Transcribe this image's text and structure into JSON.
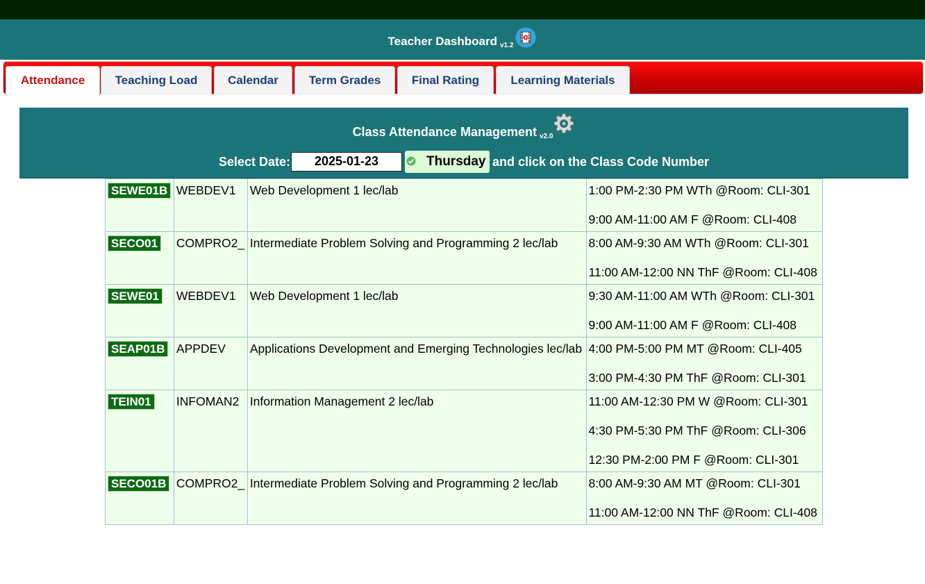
{
  "app": {
    "title": "Teacher Dashboard",
    "version": "v1.2"
  },
  "tabs": [
    {
      "label": "Attendance",
      "active": true
    },
    {
      "label": "Teaching Load",
      "active": false
    },
    {
      "label": "Calendar",
      "active": false
    },
    {
      "label": "Term Grades",
      "active": false
    },
    {
      "label": "Final Rating",
      "active": false
    },
    {
      "label": "Learning Materials",
      "active": false
    }
  ],
  "attendance": {
    "title": "Class Attendance Management",
    "version": "v2.0",
    "select_date_label": "Select Date:",
    "date_value": "2025-01-23",
    "day_name": "Thursday",
    "instruction": "and click on the Class Code Number"
  },
  "classes": [
    {
      "code": "SEWE01B",
      "subject": "WEBDEV1",
      "description": "Web Development 1 lec/lab",
      "schedules": [
        "1:00 PM-2:30 PM WTh @Room: CLI-301",
        "9:00 AM-11:00 AM F @Room: CLI-408"
      ]
    },
    {
      "code": "SECO01",
      "subject": "COMPRO2_",
      "description": "Intermediate Problem Solving and Programming 2 lec/lab",
      "schedules": [
        "8:00 AM-9:30 AM WTh @Room: CLI-301",
        "11:00 AM-12:00 NN ThF @Room: CLI-408"
      ]
    },
    {
      "code": "SEWE01",
      "subject": "WEBDEV1",
      "description": "Web Development 1 lec/lab",
      "schedules": [
        "9:30 AM-11:00 AM WTh @Room: CLI-301",
        "9:00 AM-11:00 AM F @Room: CLI-408"
      ]
    },
    {
      "code": "SEAP01B",
      "subject": "APPDEV",
      "description": "Applications Development and Emerging Technologies lec/lab",
      "schedules": [
        "4:00 PM-5:00 PM MT @Room: CLI-405",
        "3:00 PM-4:30 PM ThF @Room: CLI-301"
      ]
    },
    {
      "code": "TEIN01",
      "subject": "INFOMAN2",
      "description": "Information Management 2 lec/lab",
      "schedules": [
        "11:00 AM-12:30 PM W @Room: CLI-301",
        "4:30 PM-5:30 PM ThF @Room: CLI-306",
        "12:30 PM-2:00 PM F @Room: CLI-301"
      ]
    },
    {
      "code": "SECO01B",
      "subject": "COMPRO2_",
      "description": "Intermediate Problem Solving and Programming 2 lec/lab",
      "schedules": [
        "8:00 AM-9:30 AM MT @Room: CLI-301",
        "11:00 AM-12:00 NN ThF @Room: CLI-408"
      ]
    }
  ],
  "colors": {
    "header_teal": "#1b7478",
    "tab_red": "#cc0000",
    "active_tab_text": "#cc1111",
    "tab_text": "#1c3f75",
    "code_badge": "#0f6a16",
    "table_bg": "#eeffea",
    "day_badge": "#dcfcd8"
  }
}
